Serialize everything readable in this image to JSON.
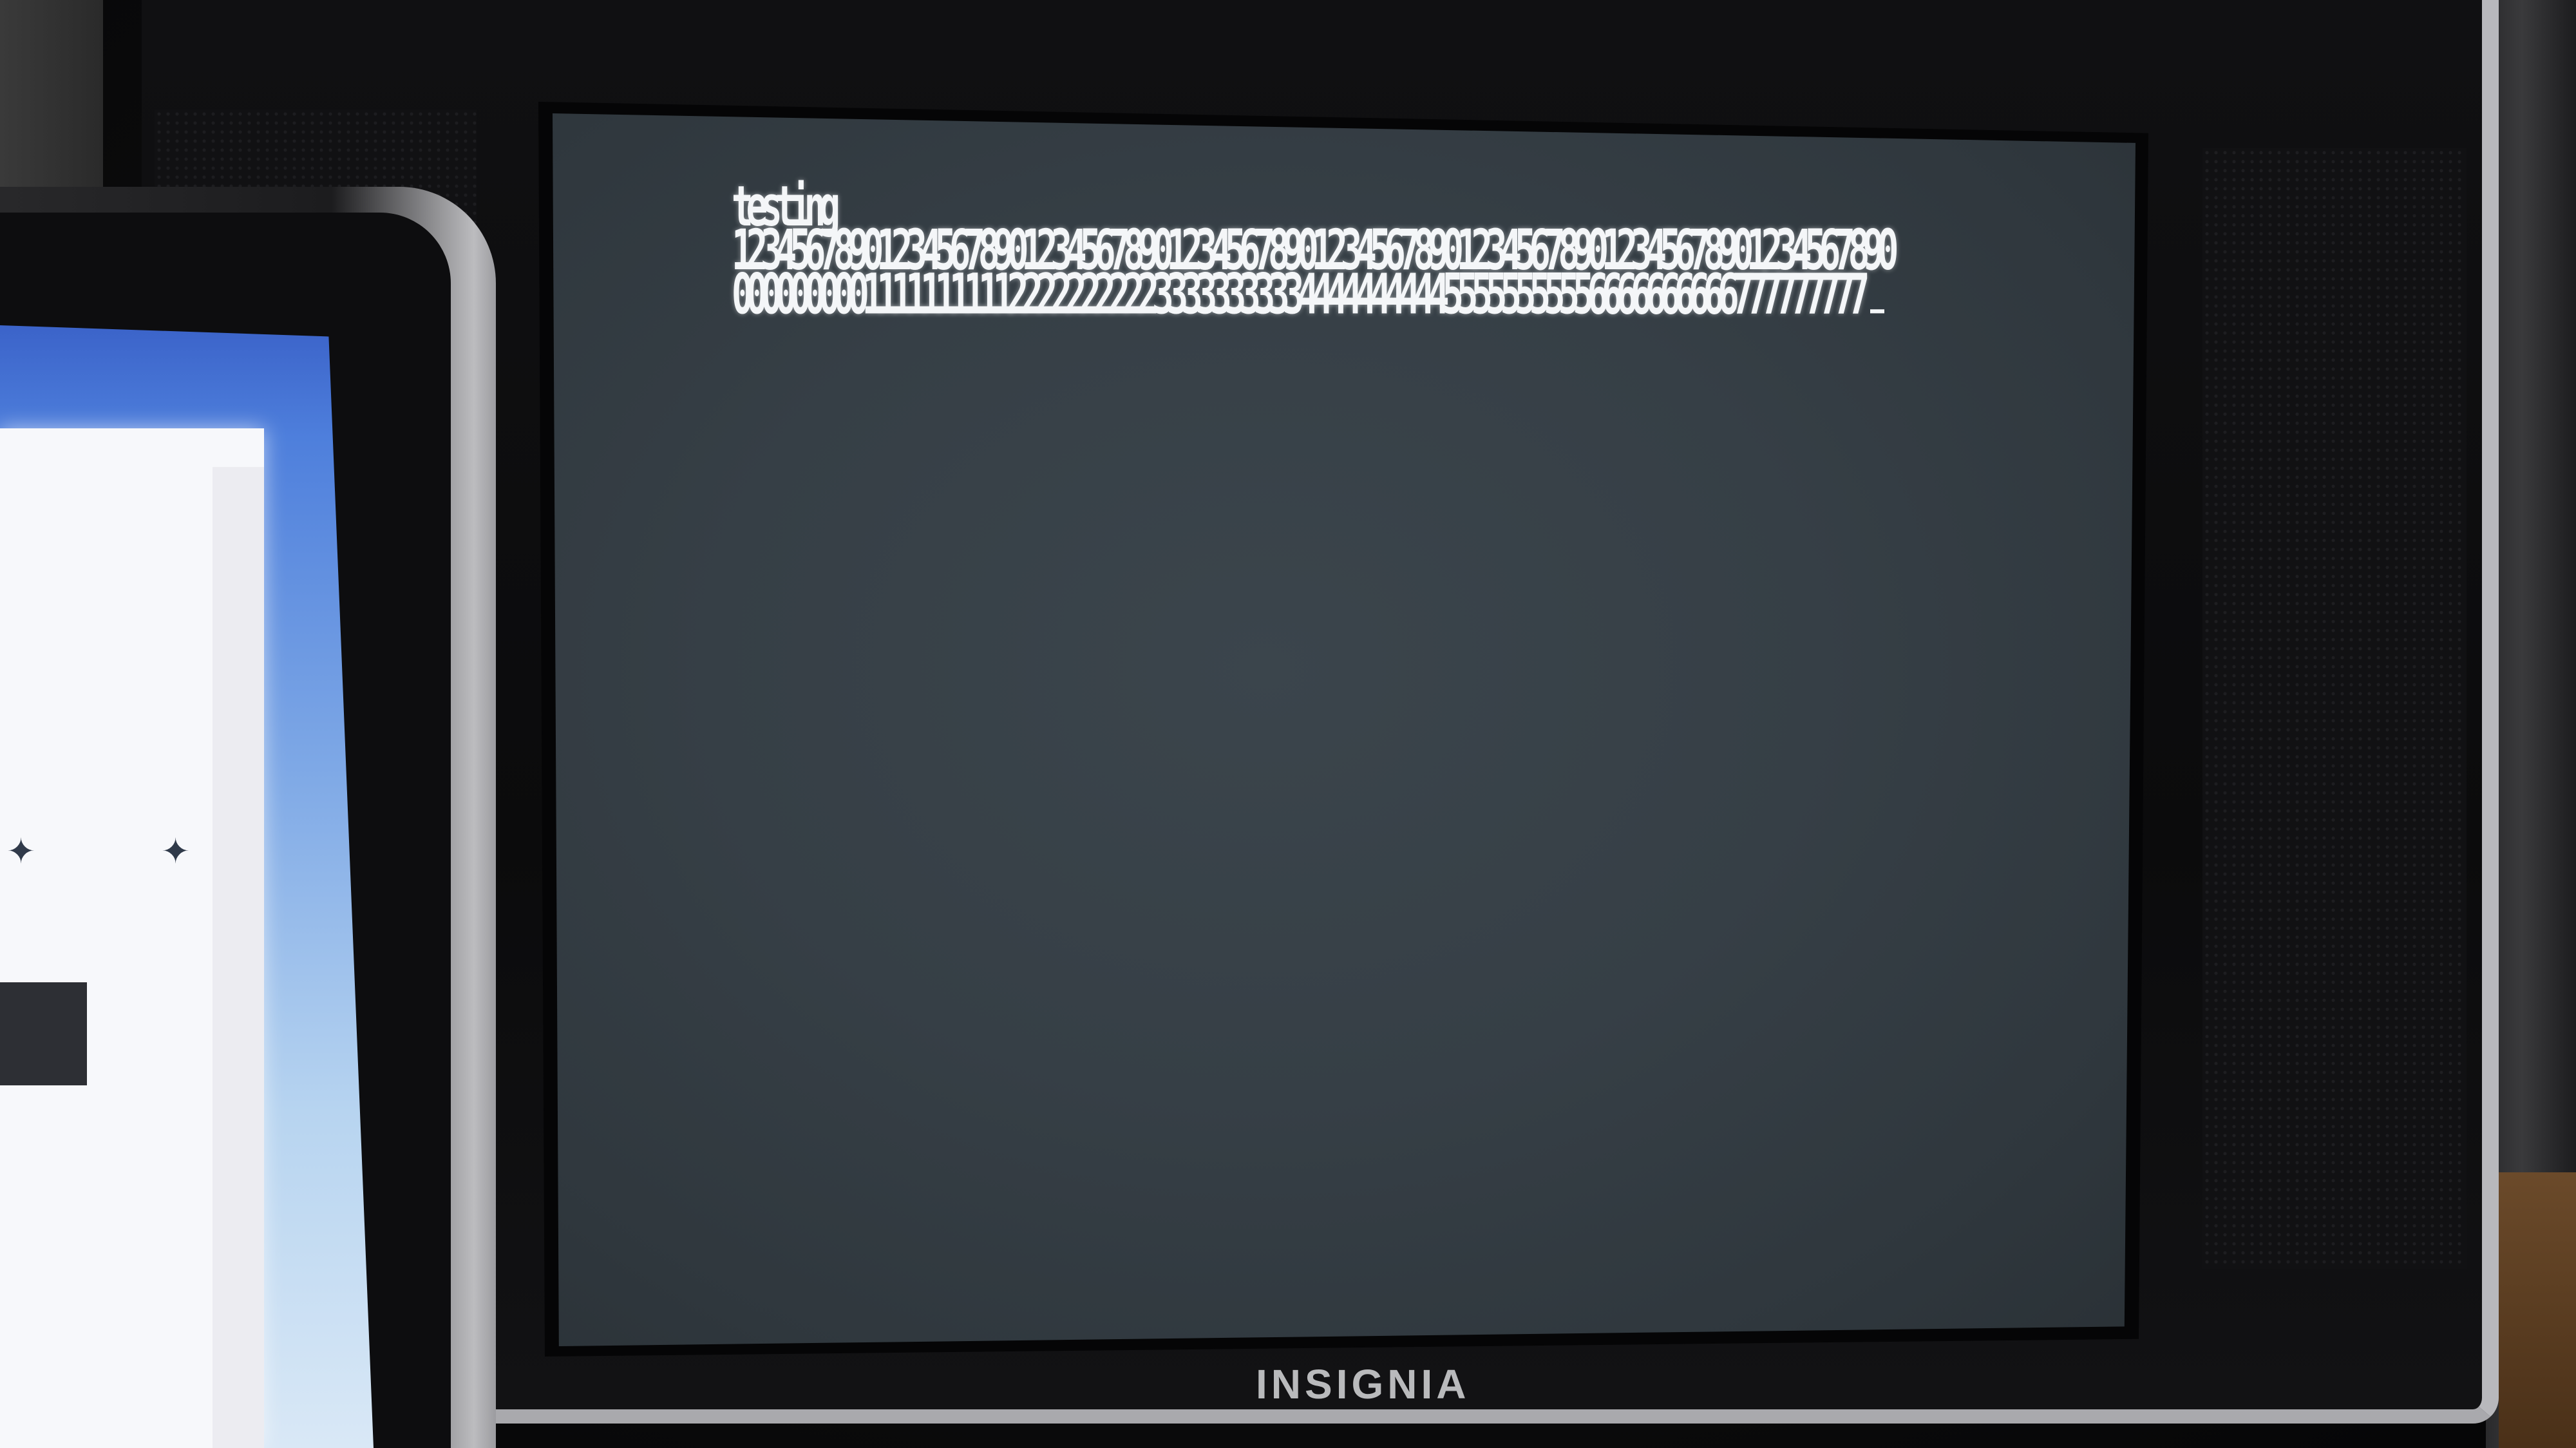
{
  "terminal": {
    "lines": [
      "testing",
      "12345678901234567890123456789012345678901234567890123456789012345678901234567890",
      "000000000111111111122222222223333333333444444444455555555556666666666777777777"
    ],
    "text_color": "#f4f6f8",
    "screen_color": "#363f46"
  },
  "tv": {
    "brand_logo": "INSIGNIA",
    "bezel_color": "#0b0b0c",
    "trim_color": "#b8b8bc"
  },
  "laptop": {
    "wallpaper_color": "#4e7fdc"
  }
}
